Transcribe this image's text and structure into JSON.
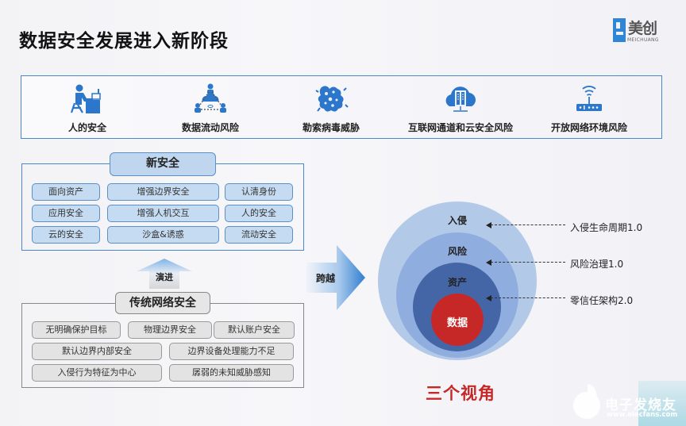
{
  "header": {
    "title": "数据安全发展进入新阶段",
    "logo": {
      "cn": "美创",
      "en": "MEICHUANG",
      "brand_color": "#2f86d6"
    }
  },
  "threats": [
    {
      "icon": "person-at-desk-icon",
      "label": "人的安全"
    },
    {
      "icon": "network-people-icon",
      "label": "数据流动风险"
    },
    {
      "icon": "virus-icon",
      "label": "勒索病毒威胁"
    },
    {
      "icon": "cloud-server-icon",
      "label": "互联网通道和云安全风险"
    },
    {
      "icon": "wifi-router-icon",
      "label": "开放网络环境风险"
    }
  ],
  "new_security": {
    "title": "新安全",
    "items": [
      [
        "面向资产",
        "增强边界安全",
        "认清身份"
      ],
      [
        "应用安全",
        "增强人机交互",
        "人的安全"
      ],
      [
        "云的安全",
        "沙盒&诱惑",
        "流动安全"
      ]
    ]
  },
  "evolve_label": "演进",
  "traditional_security": {
    "title": "传统网络安全",
    "row1": [
      "无明确保护目标",
      "物理边界安全",
      "默认账户安全"
    ],
    "row2": [
      "默认边界内部安全",
      "边界设备处理能力不足"
    ],
    "row3": [
      "入侵行为特征为中心",
      "孱弱的未知威胁感知"
    ]
  },
  "cross_label": "跨越",
  "perspectives": {
    "rings": [
      {
        "label": "入侵",
        "color": "#b3c9e8"
      },
      {
        "label": "风险",
        "color": "#8fadde"
      },
      {
        "label": "资产",
        "color": "#4566a6"
      },
      {
        "label": "数据",
        "color": "#c62828"
      }
    ],
    "pointers": [
      "入侵生命周期1.0",
      "风险治理1.0",
      "零信任架构2.0"
    ],
    "caption": "三个视角"
  },
  "watermark": {
    "cn": "电子发烧友",
    "url": "www.elecfans.com"
  }
}
